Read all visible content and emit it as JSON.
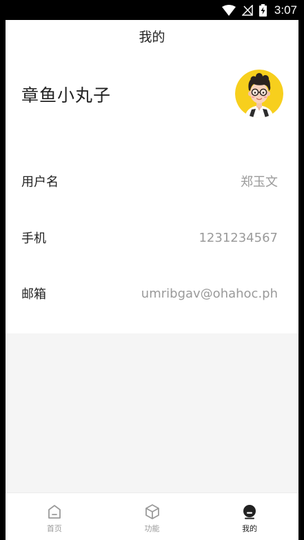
{
  "status_bar": {
    "time": "3:07",
    "icons": [
      "wifi-icon",
      "no-signal-icon",
      "battery-charging-icon"
    ]
  },
  "header": {
    "title": "我的"
  },
  "profile": {
    "nickname": "章鱼小丸子",
    "avatar": "cartoon-avatar-glasses"
  },
  "info": {
    "rows": [
      {
        "label": "用户名",
        "value": "郑玉文"
      },
      {
        "label": "手机",
        "value": "1231234567"
      },
      {
        "label": "邮箱",
        "value": "umribgav@ohahoc.ph"
      }
    ]
  },
  "bottom_nav": {
    "items": [
      {
        "label": "首页",
        "icon": "home-icon",
        "active": false
      },
      {
        "label": "功能",
        "icon": "cube-icon",
        "active": false
      },
      {
        "label": "我的",
        "icon": "user-icon",
        "active": true
      }
    ],
    "colors": {
      "active": "#222222",
      "inactive": "#9a9a9a"
    }
  }
}
